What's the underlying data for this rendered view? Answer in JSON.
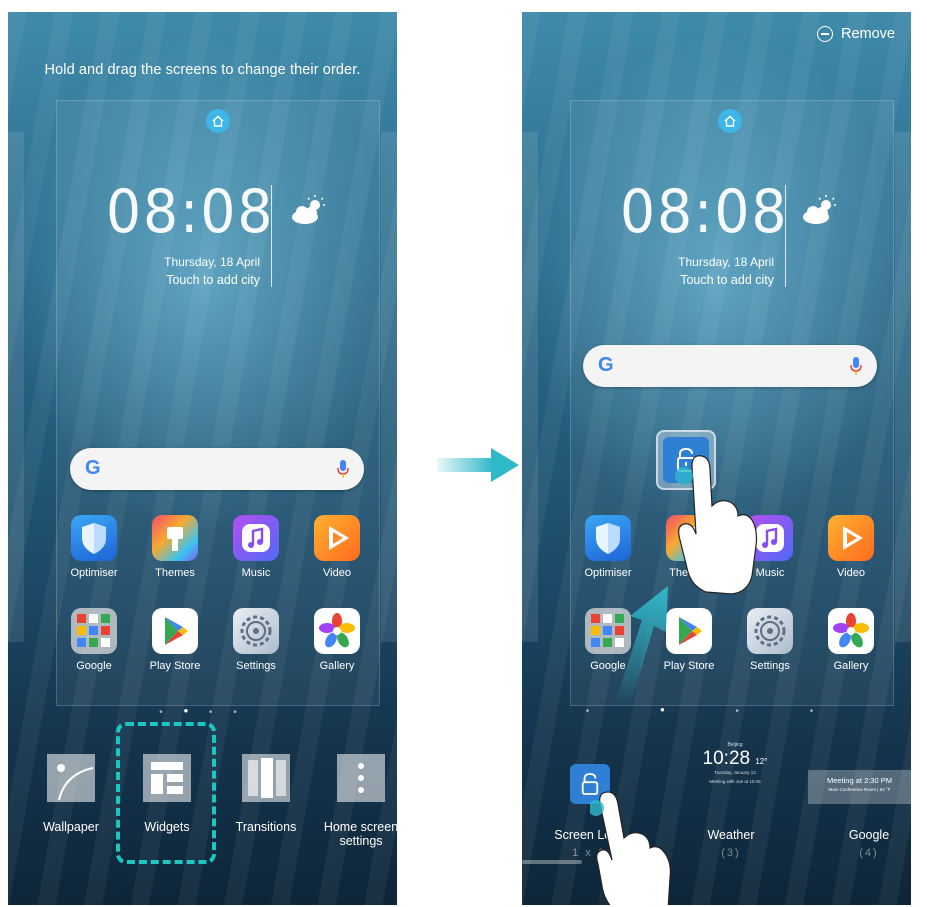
{
  "left_screen": {
    "instruction": "Hold and drag the screens to change their order.",
    "clock": "08:08",
    "date": "Thursday, 18 April",
    "city_prompt": "Touch to add city",
    "search_logo": "G",
    "apps": [
      {
        "label": "Optimiser",
        "icon": "shield-icon"
      },
      {
        "label": "Themes",
        "icon": "paintbrush-icon"
      },
      {
        "label": "Music",
        "icon": "music-note-icon"
      },
      {
        "label": "Video",
        "icon": "play-icon"
      },
      {
        "label": "Google",
        "icon": "folder-grid-icon"
      },
      {
        "label": "Play Store",
        "icon": "play-store-icon"
      },
      {
        "label": "Settings",
        "icon": "gear-icon"
      },
      {
        "label": "Gallery",
        "icon": "flower-icon"
      }
    ],
    "tray": [
      {
        "label": "Wallpaper",
        "icon": "wallpaper-icon"
      },
      {
        "label": "Widgets",
        "icon": "widgets-icon"
      },
      {
        "label": "Transitions",
        "icon": "transitions-icon"
      },
      {
        "label": "Home screen settings",
        "icon": "home-settings-icon"
      }
    ]
  },
  "right_screen": {
    "remove_label": "Remove",
    "clock": "08:08",
    "date": "Thursday, 18 April",
    "city_prompt": "Touch to add city",
    "search_logo": "G",
    "apps": [
      {
        "label": "Optimiser"
      },
      {
        "label": "Themes"
      },
      {
        "label": "Music"
      },
      {
        "label": "Video"
      },
      {
        "label": "Google"
      },
      {
        "label": "Play Store"
      },
      {
        "label": "Settings"
      },
      {
        "label": "Gallery"
      }
    ],
    "widgets": [
      {
        "label": "Screen Lock",
        "size": "1 x 1"
      },
      {
        "label": "Weather",
        "size": "(3)"
      },
      {
        "label": "Google",
        "size": "(4)"
      }
    ],
    "weather_widget": {
      "city": "Beijing",
      "time": "10:28",
      "temp": "12°",
      "date": "Tuesday, January 12",
      "meeting": "Meeting with Joe at 10:45"
    },
    "google_widget": {
      "title": "Meeting at 2:30 PM",
      "detail": "Main Conference Room",
      "temp": "64 °F"
    }
  },
  "colors": {
    "accent_dash": "#1cc7c2",
    "arrow": "#2fb8c8",
    "lock_blue": "#2f7fd4"
  }
}
